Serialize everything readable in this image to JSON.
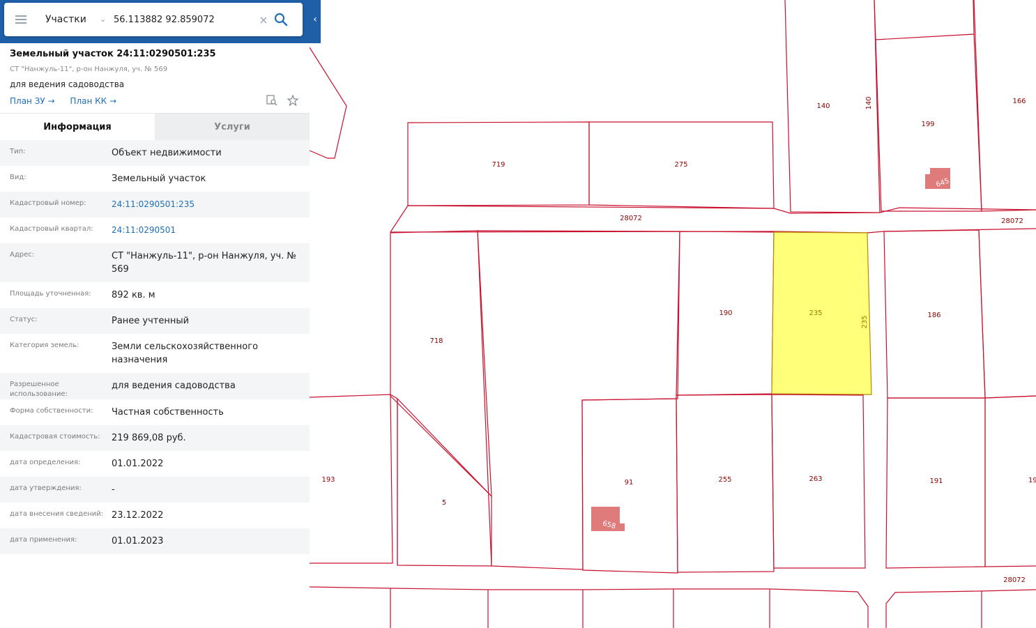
{
  "search": {
    "layer": "Участки",
    "query": "56.113882 92.859072"
  },
  "parcel": {
    "title": "Земельный участок 24:11:0290501:235",
    "address_short": "СТ \"Нанжуль-11\", р-он Нанжуля, уч. № 569",
    "use": "для ведения садоводства",
    "links": [
      "План ЗУ →",
      "План КК →"
    ]
  },
  "tabs": [
    "Информация",
    "Услуги"
  ],
  "info": [
    {
      "key": "Тип:",
      "value": "Объект недвижимости"
    },
    {
      "key": "Вид:",
      "value": "Земельный участок"
    },
    {
      "key": "Кадастровый номер:",
      "value": "24:11:0290501:235",
      "link": true
    },
    {
      "key": "Кадастровый квартал:",
      "value": "24:11:0290501",
      "link": true
    },
    {
      "key": "Адрес:",
      "value": "СТ \"Нанжуль-11\", р-он Нанжуля, уч. № 569"
    },
    {
      "key": "Площадь уточненная:",
      "value": "892 кв. м"
    },
    {
      "key": "Статус:",
      "value": "Ранее учтенный"
    },
    {
      "key": "Категория земель:",
      "value": "Земли сельскохозяйственного назначения"
    },
    {
      "key": "Разрешенное использование:",
      "value": "для ведения садоводства"
    },
    {
      "key": "Форма собственности:",
      "value": "Частная собственность"
    },
    {
      "key": "Кадастровая стоимость:",
      "value": "219 869,08 руб."
    },
    {
      "key": "дата определения:",
      "value": "01.01.2022"
    },
    {
      "key": "дата утверждения:",
      "value": "-"
    },
    {
      "key": "дата внесения сведений:",
      "value": "23.12.2022"
    },
    {
      "key": "дата применения:",
      "value": "01.01.2023"
    }
  ],
  "map_labels": [
    "140",
    "140",
    "199",
    "166",
    "719",
    "275",
    "645",
    "28072",
    "28072",
    "718",
    "190",
    "235",
    "235",
    "186",
    "193",
    "5",
    "91",
    "658",
    "255",
    "263",
    "191",
    "19",
    "28072"
  ],
  "colors": {
    "parcel_border": "#c8102e",
    "selected_fill": "#ffff7a",
    "building_fill": "#e07b7b",
    "link": "#1e6fb8",
    "search_bar_bg": "#1e5fa8"
  }
}
